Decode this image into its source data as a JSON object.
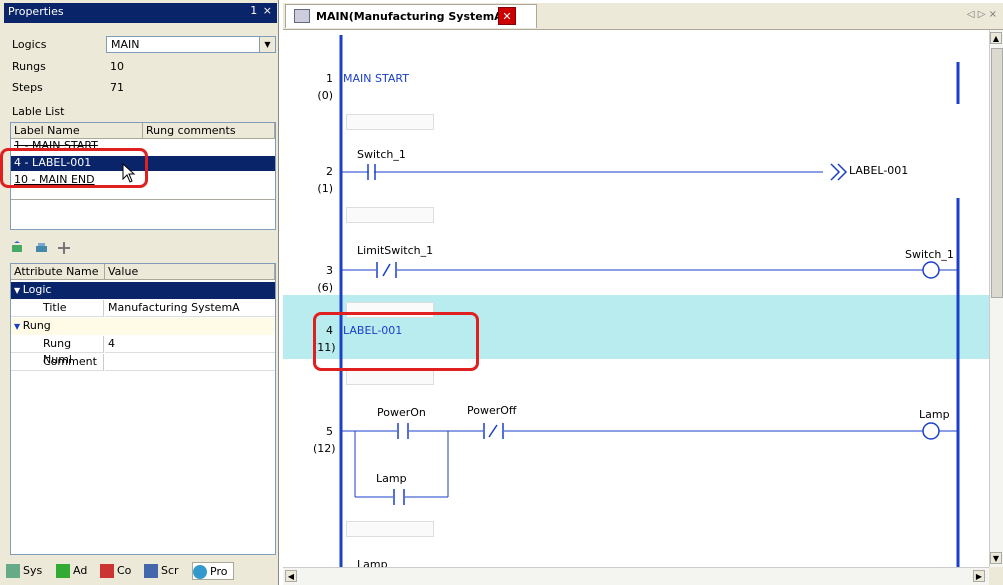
{
  "properties": {
    "title": "Properties",
    "pin": "1 ×",
    "logics_label": "Logics",
    "logics_value": "MAIN",
    "rungs_label": "Rungs",
    "rungs_value": "10",
    "steps_label": "Steps",
    "steps_value": "71",
    "lable_list_label": "Lable List",
    "label_columns": [
      "Label Name",
      "Rung comments"
    ],
    "labels": [
      "1 - MAIN START",
      "4 - LABEL-001",
      "10 - MAIN END"
    ],
    "attr_columns": [
      "Attribute Name",
      "Value"
    ],
    "logic_group": "Logic",
    "title_attr": "Title",
    "title_value": "Manufacturing SystemA",
    "rung_group": "Rung",
    "rung_num_attr": "Rung Numl",
    "rung_num_value": "4",
    "comment_attr": "Comment",
    "comment_value": ""
  },
  "bottom_tabs": [
    "Sys",
    "Ad",
    "Co",
    "Scr",
    "Pro"
  ],
  "document": {
    "tab_title": "MAIN(Manufacturing SystemA)",
    "nav": "◁ ▷ ×"
  },
  "ladder": {
    "rung1": {
      "num": "1",
      "step": "(0)",
      "label": "MAIN START"
    },
    "rung2": {
      "num": "2",
      "step": "(1)",
      "contact": "Switch_1",
      "jump": "LABEL-001"
    },
    "rung3": {
      "num": "3",
      "step": "(6)",
      "contact": "LimitSwitch_1",
      "coil": "Switch_1"
    },
    "rung4": {
      "num": "4",
      "step": "(11)",
      "label": "LABEL-001"
    },
    "rung5": {
      "num": "5",
      "step": "(12)",
      "contact1": "PowerOn",
      "contact2": "PowerOff",
      "contact3": "Lamp",
      "coil": "Lamp"
    },
    "rung6": {
      "contact": "Lamp"
    }
  },
  "colors": {
    "accent": "#0a246a",
    "rail": "#1a3fc8",
    "highlight": "#b9ecef",
    "annotation": "#e02020"
  }
}
